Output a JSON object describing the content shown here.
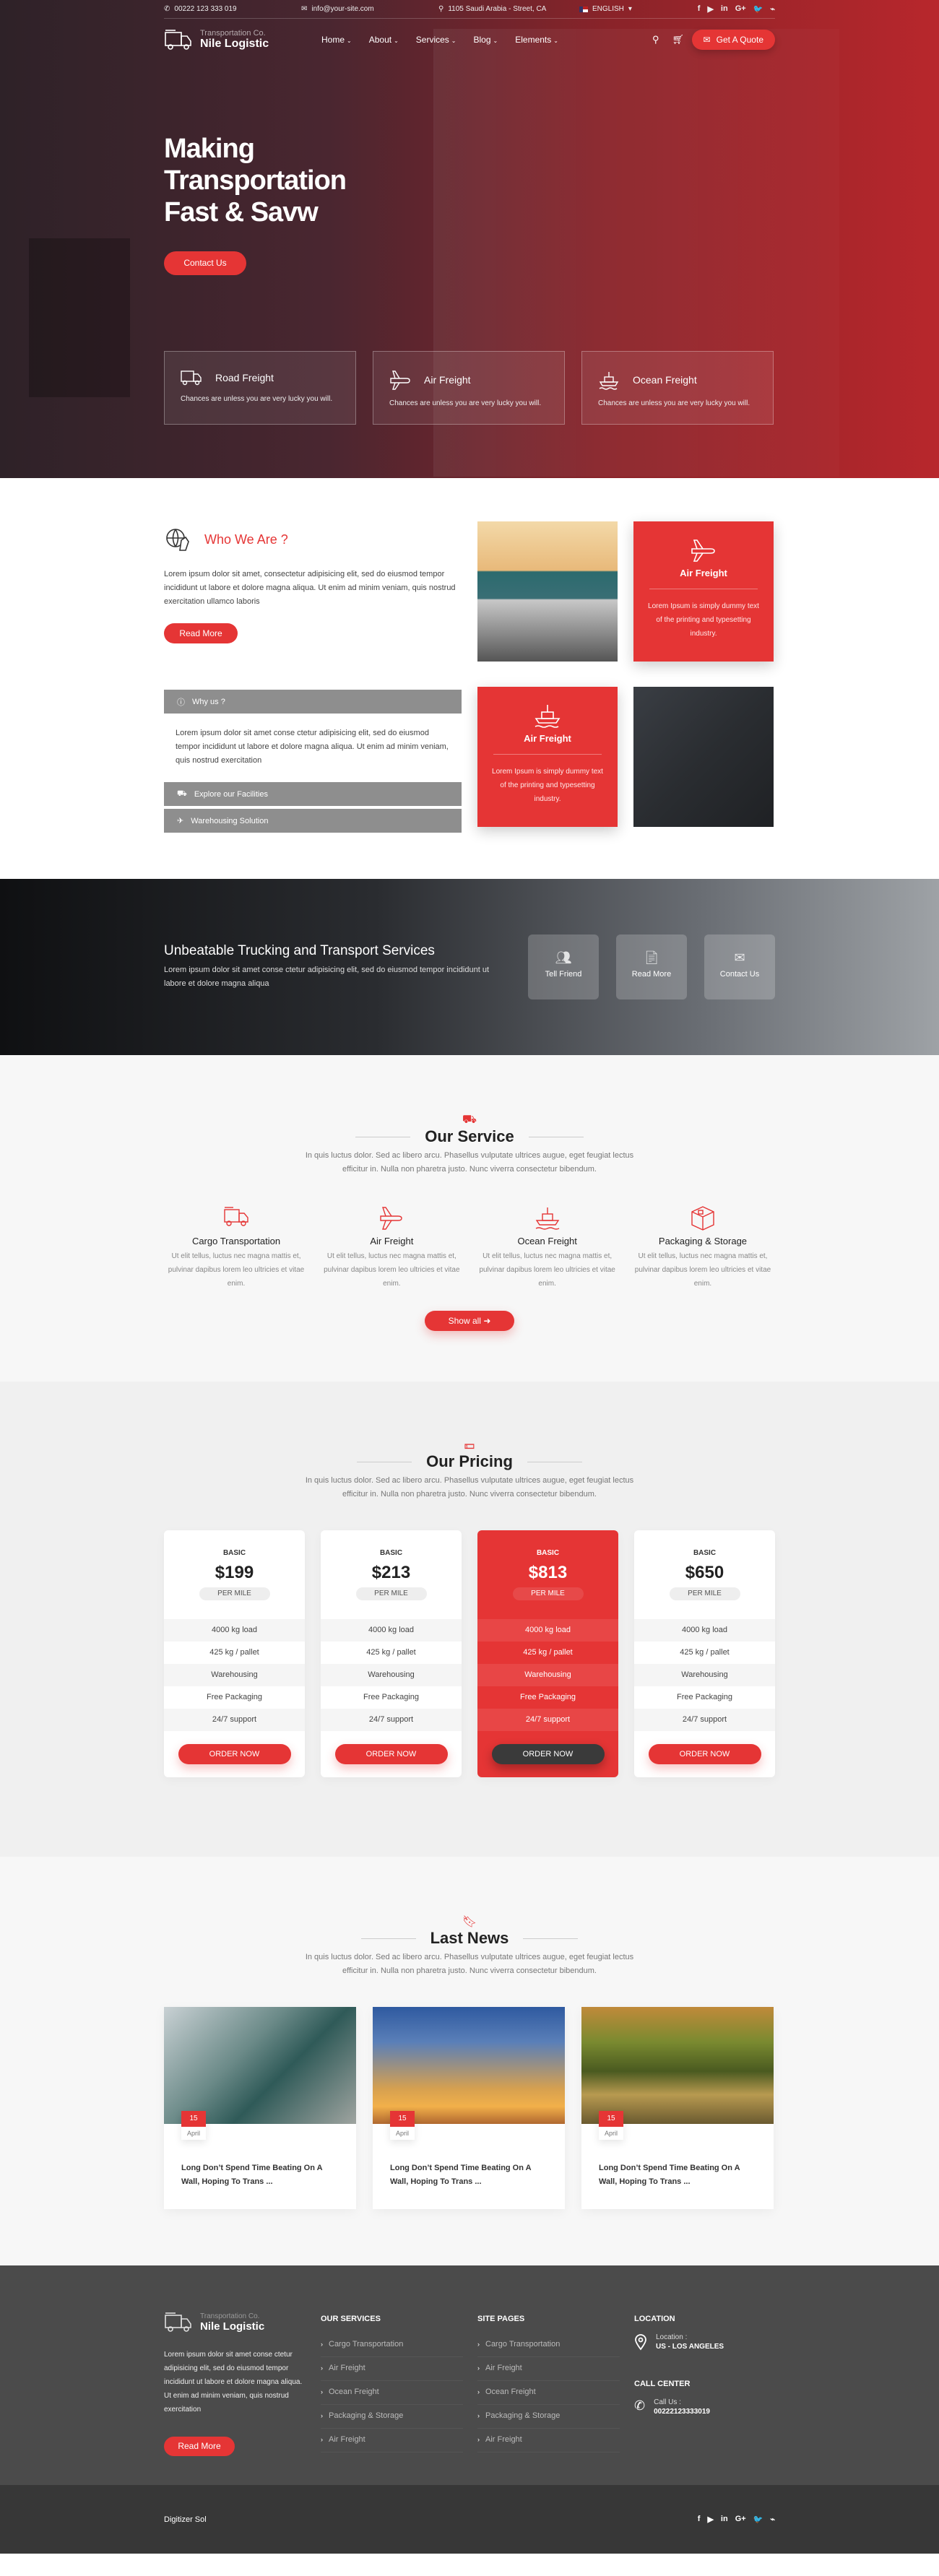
{
  "topbar": {
    "phone": "00222 123 333 019",
    "email": "info@your-site.com",
    "address": "1105 Saudi Arabia - Street, CA",
    "language": "ENGLISH"
  },
  "social": [
    "f",
    "▶",
    "in",
    "G+",
    "🐦",
    "⌁"
  ],
  "brand": {
    "tagline": "Transportation Co.",
    "name": "Nile Logistic"
  },
  "nav": [
    {
      "label": "Home"
    },
    {
      "label": "About"
    },
    {
      "label": "Services"
    },
    {
      "label": "Blog"
    },
    {
      "label": "Elements"
    }
  ],
  "header": {
    "quote_label": "Get A Quote"
  },
  "hero": {
    "title_lines": [
      "Making",
      "Transportation",
      "Fast & Savw"
    ],
    "cta_label": "Contact Us",
    "cards": [
      {
        "icon": "truck-icon",
        "title": "Road Freight",
        "text": "Chances are unless you are very lucky you will."
      },
      {
        "icon": "plane-icon",
        "title": "Air Freight",
        "text": "Chances are unless you are very lucky you will."
      },
      {
        "icon": "ship-icon",
        "title": "Ocean Freight",
        "text": "Chances are unless you are very lucky you will."
      }
    ]
  },
  "about": {
    "title": "Who We Are ?",
    "text": "Lorem ipsum dolor sit amet, consectetur adipisicing elit, sed do eiusmod tempor incididunt ut labore et dolore magna aliqua. Ut enim ad minim veniam, quis nostrud exercitation ullamco laboris",
    "read_more": "Read More",
    "accordion": [
      {
        "icon": "info-icon",
        "label": "Why us ?",
        "body": "Lorem ipsum dolor sit amet conse ctetur adipisicing elit, sed do eiusmod tempor incididunt ut labore et dolore magna aliqua. Ut enim ad minim veniam, quis nostrud exercitation"
      },
      {
        "icon": "truck-icon",
        "label": "Explore our Facilities"
      },
      {
        "icon": "plane-icon",
        "label": "Warehousing Solution"
      }
    ],
    "tiles": [
      {
        "title": "Air Freight",
        "text": "Lorem Ipsum is simply dummy text of the printing and typesetting industry."
      },
      {
        "title": "Air Freight",
        "text": "Lorem Ipsum is simply dummy text of the printing and typesetting industry."
      }
    ]
  },
  "banner": {
    "title": "Unbeatable Trucking and Transport Services",
    "text": "Lorem ipsum dolor sit amet conse ctetur adipisicing elit, sed do eiusmod tempor incididunt ut labore et dolore magna aliqua",
    "buttons": [
      {
        "icon": "users-icon",
        "label": "Tell Friend"
      },
      {
        "icon": "document-icon",
        "label": "Read More"
      },
      {
        "icon": "mail-icon",
        "label": "Contact Us"
      }
    ]
  },
  "services": {
    "title": "Our Service",
    "subtitle": "In quis luctus dolor. Sed ac libero arcu. Phasellus vulputate ultrices augue, eget feugiat lectus efficitur in. Nulla non pharetra justo. Nunc viverra consectetur bibendum.",
    "items": [
      {
        "title": "Cargo Transportation",
        "text": "Ut elit tellus, luctus nec magna mattis et, pulvinar dapibus lorem leo ultricies et vitae enim."
      },
      {
        "title": "Air Freight",
        "text": "Ut elit tellus, luctus nec magna mattis et, pulvinar dapibus lorem leo ultricies et vitae enim."
      },
      {
        "title": "Ocean Freight",
        "text": "Ut elit tellus, luctus nec magna mattis et, pulvinar dapibus lorem leo ultricies et vitae enim."
      },
      {
        "title": "Packaging & Storage",
        "text": "Ut elit tellus, luctus nec magna mattis et, pulvinar dapibus lorem leo ultricies et vitae enim."
      }
    ],
    "show_all": "Show all"
  },
  "pricing": {
    "title": "Our Pricing",
    "subtitle": "In quis luctus dolor. Sed ac libero arcu. Phasellus vulputate ultrices augue, eget feugiat lectus efficitur in. Nulla non pharetra justo. Nunc viverra consectetur bibendum.",
    "plans": [
      {
        "tier": "BASIC",
        "price": "$199",
        "unit": "PER MILE",
        "features": [
          "4000 kg load",
          "425 kg / pallet",
          "Warehousing",
          "Free Packaging",
          "24/7 support"
        ],
        "cta": "ORDER NOW",
        "featured": false
      },
      {
        "tier": "BASIC",
        "price": "$213",
        "unit": "PER MILE",
        "features": [
          "4000 kg load",
          "425 kg / pallet",
          "Warehousing",
          "Free Packaging",
          "24/7 support"
        ],
        "cta": "ORDER NOW",
        "featured": false
      },
      {
        "tier": "BASIC",
        "price": "$813",
        "unit": "PER MILE",
        "features": [
          "4000 kg load",
          "425 kg / pallet",
          "Warehousing",
          "Free Packaging",
          "24/7 support"
        ],
        "cta": "ORDER NOW",
        "featured": true
      },
      {
        "tier": "BASIC",
        "price": "$650",
        "unit": "PER MILE",
        "features": [
          "4000 kg load",
          "425 kg / pallet",
          "Warehousing",
          "Free Packaging",
          "24/7 support"
        ],
        "cta": "ORDER NOW",
        "featured": false
      }
    ]
  },
  "news": {
    "title": "Last News",
    "subtitle": "In quis luctus dolor. Sed ac libero arcu. Phasellus vulputate ultrices augue, eget feugiat lectus efficitur in. Nulla non pharetra justo. Nunc viverra consectetur bibendum.",
    "posts": [
      {
        "day": "15",
        "month": "April",
        "title": "Long Don’t Spend Time Beating On A Wall, Hoping To Trans ..."
      },
      {
        "day": "15",
        "month": "April",
        "title": "Long Don’t Spend Time Beating On A Wall, Hoping To Trans ..."
      },
      {
        "day": "15",
        "month": "April",
        "title": "Long Don’t Spend Time Beating On A Wall, Hoping To Trans ..."
      }
    ]
  },
  "footer": {
    "about": "Lorem ipsum dolor sit amet conse ctetur adipisicing elit, sed do eiusmod tempor incididunt ut labore et dolore magna aliqua. Ut enim ad minim veniam, quis nostrud exercitation",
    "read_more": "Read More",
    "services_title": "OUR SERVICES",
    "services_links": [
      "Cargo Transportation",
      "Air Freight",
      "Ocean Freight",
      "Packaging & Storage",
      "Air Freight"
    ],
    "pages_title": "SITE PAGES",
    "pages_links": [
      "Cargo Transportation",
      "Air Freight",
      "Ocean Freight",
      "Packaging & Storage",
      "Air Freight"
    ],
    "location_title": "LOCATION",
    "location_label": "Location :",
    "location_value": "US - LOS ANGELES",
    "call_title": "CALL CENTER",
    "call_label": "Call Us :",
    "call_value": "00222123333019",
    "copyright": "Digitizer Sol"
  },
  "colors": {
    "accent": "#e53535",
    "footer": "#4b4b4b",
    "bottom": "#373737"
  }
}
